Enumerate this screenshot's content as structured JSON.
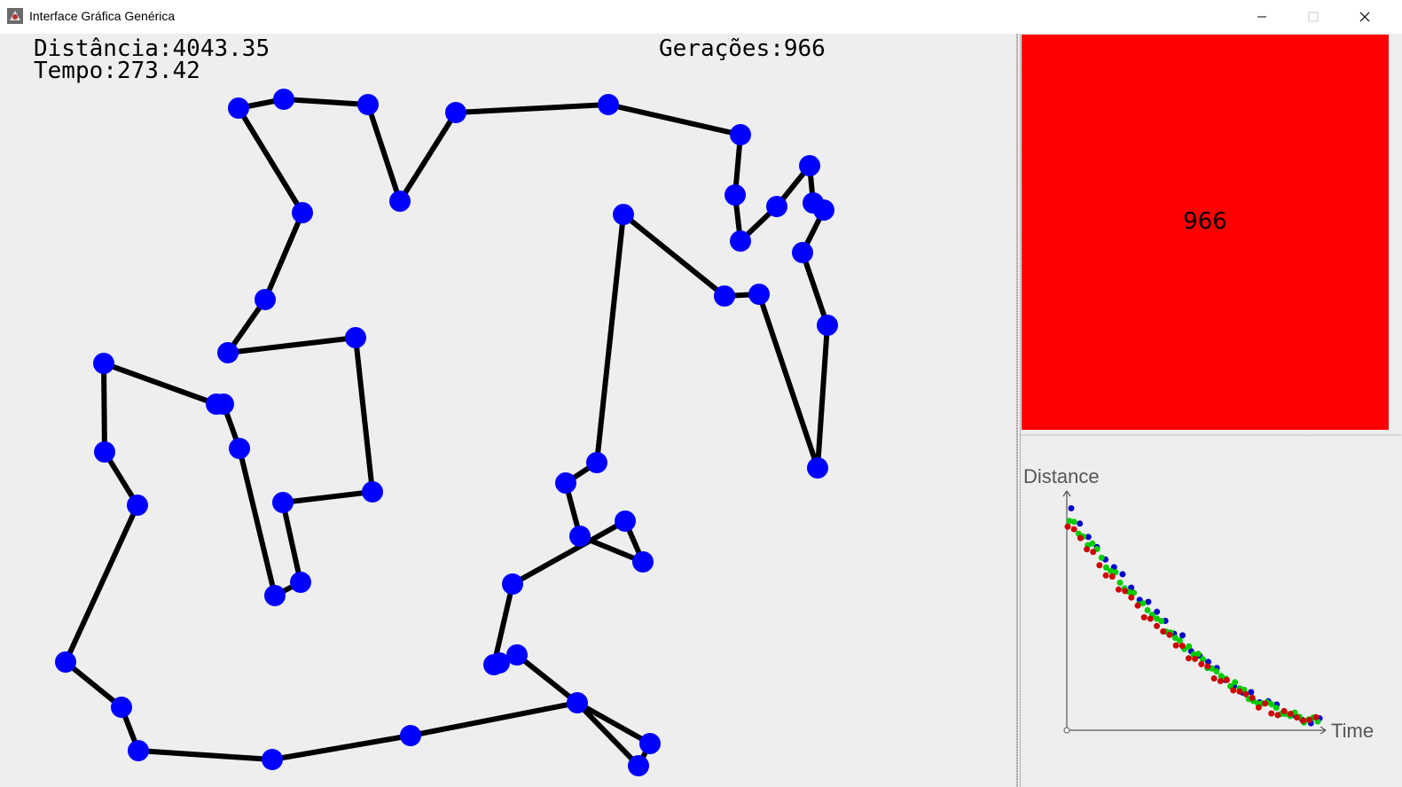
{
  "window": {
    "title": "Interface Gráfica Genérica",
    "controls": [
      "minimize-icon",
      "maximize-icon",
      "close-icon"
    ]
  },
  "stats": {
    "distance": "Distância:4043.35",
    "time": "Tempo:273.42",
    "generations": "Gerações:966"
  },
  "colors": {
    "city": "#0000ff",
    "route": "#000000",
    "background": "#eeeeee",
    "generation_box": "#ff0000",
    "series_red": "#cc0000",
    "series_green": "#00cc00",
    "series_blue": "#0000cc"
  },
  "generation_box": {
    "value": "966"
  },
  "plot": {
    "ylabel": "Distance",
    "xlabel": "Time"
  }
}
